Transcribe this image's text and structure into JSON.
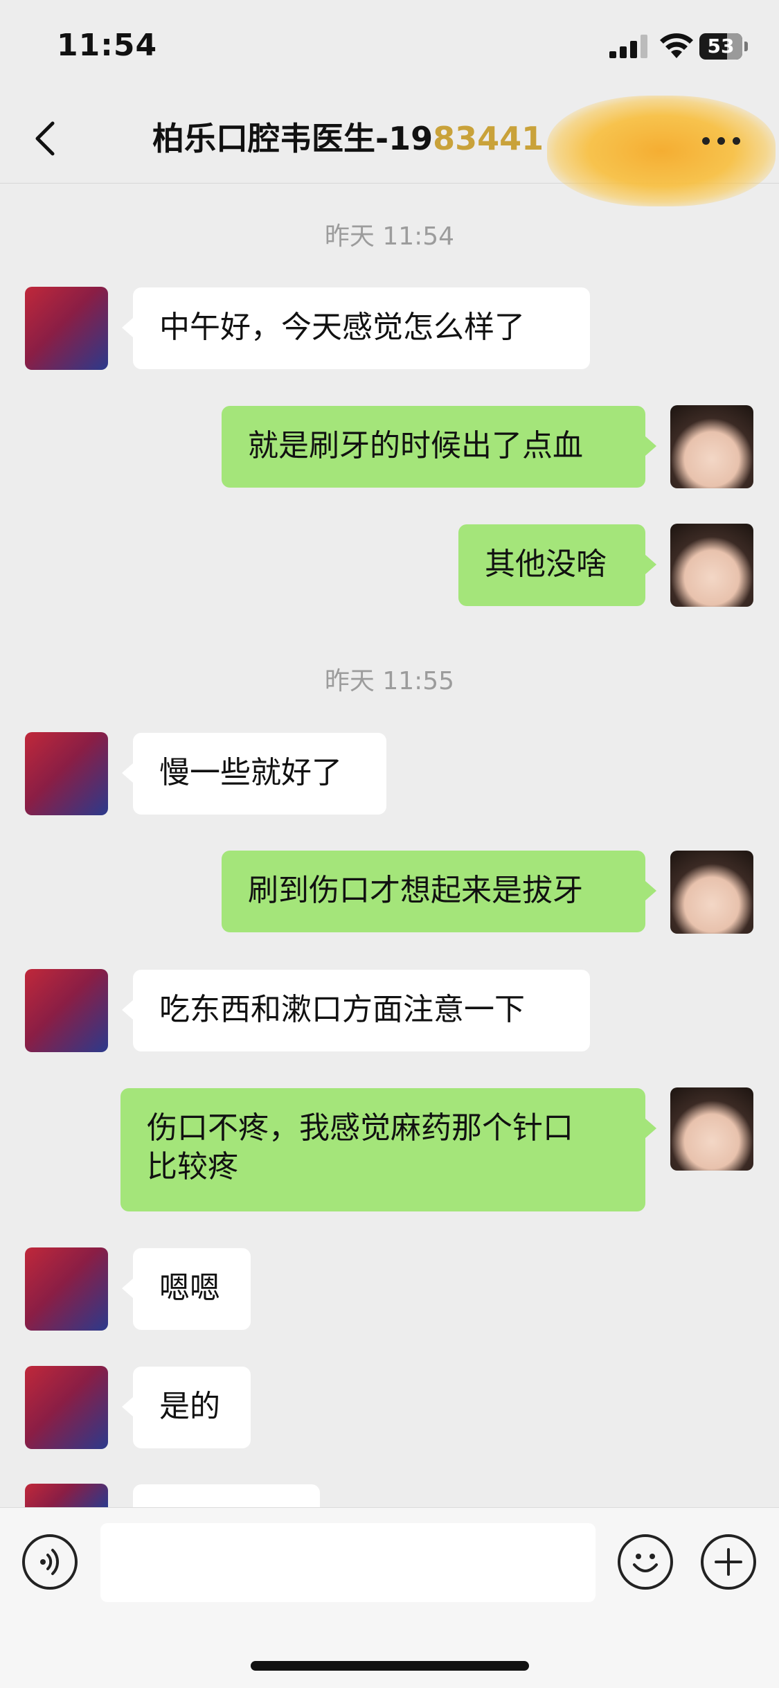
{
  "status_bar": {
    "time": "11:54",
    "battery": "53"
  },
  "header": {
    "title": "柏乐口腔韦医生-19",
    "title_suffix": "83441"
  },
  "messages": [
    {
      "type": "timestamp",
      "text": "昨天 11:54"
    },
    {
      "type": "left",
      "text": "中午好，今天感觉怎么样了"
    },
    {
      "type": "right",
      "text": "就是刷牙的时候出了点血"
    },
    {
      "type": "right",
      "text": "其他没啥"
    },
    {
      "type": "timestamp",
      "text": "昨天 11:55"
    },
    {
      "type": "left",
      "text": "慢一些就好了"
    },
    {
      "type": "right",
      "text": "刷到伤口才想起来是拔牙"
    },
    {
      "type": "left",
      "text": "吃东西和漱口方面注意一下"
    },
    {
      "type": "right",
      "text": "伤口不疼，我感觉麻药那个针口\n比较疼"
    },
    {
      "type": "left",
      "text": "嗯嗯"
    },
    {
      "type": "left",
      "text": "是的"
    }
  ],
  "icons": [
    "back-icon",
    "more-icon",
    "voice-icon",
    "emoji-icon",
    "plus-icon",
    "signal-icon",
    "wifi-icon",
    "battery-icon"
  ]
}
